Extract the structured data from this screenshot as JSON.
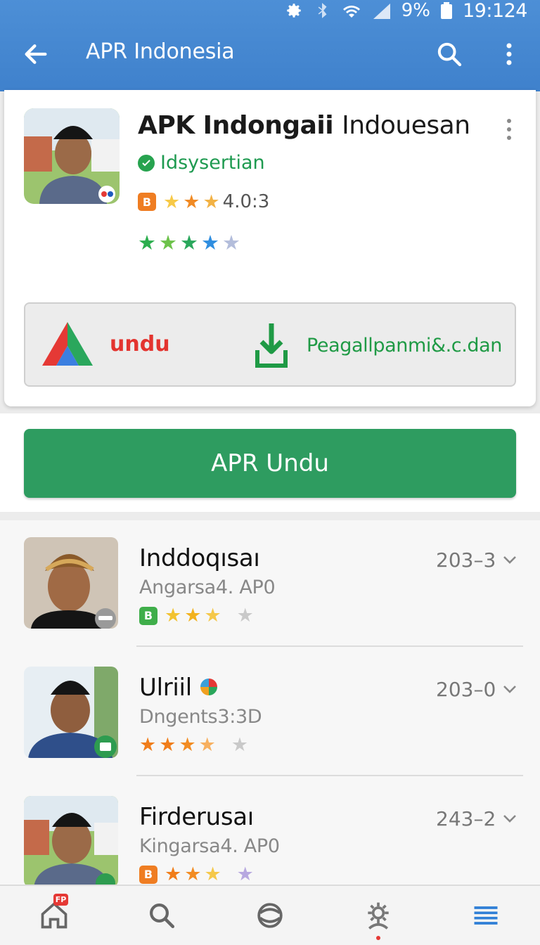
{
  "status_bar": {
    "battery": "9%",
    "time": "19:124"
  },
  "header": {
    "title": "APR Indonesia"
  },
  "app": {
    "name_bold": "APK Indongaii",
    "name_light": "Indouesan",
    "developer": "Idsysertian",
    "rating": "4.0:3",
    "download_left_label": "undu",
    "download_right_label": "Peagallpanmi&.c.dan"
  },
  "primary_button": {
    "label": "APR Undu"
  },
  "list": [
    {
      "name": "Inddoqısaı",
      "sub": "Angarsa4. AP0",
      "meta": "203–3"
    },
    {
      "name": "Ulriil",
      "sub": "Dngents3:3D",
      "meta": "203–0"
    },
    {
      "name": "Firderusaı",
      "sub": "Kingarsa4. AP0",
      "meta": "243–2"
    }
  ],
  "nav": {
    "home_badge": "FP"
  },
  "colors": {
    "appbar": "#4389d2",
    "primary": "#2e9c60",
    "verified": "#27a34f",
    "accent_red": "#e3342f"
  }
}
